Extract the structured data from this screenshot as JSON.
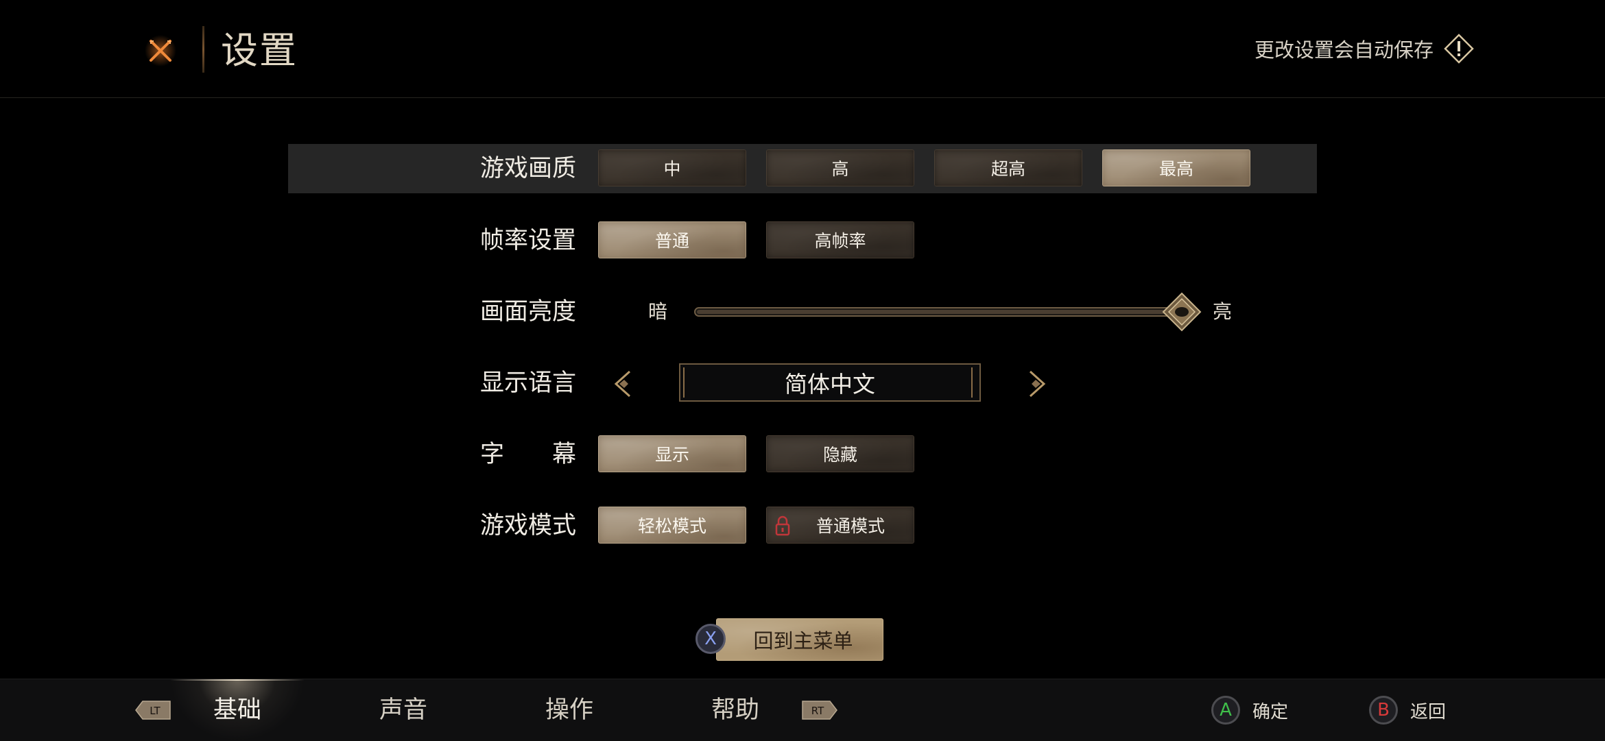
{
  "header": {
    "title": "设置",
    "autosave_notice": "更改设置会自动保存",
    "close_icon": "crossed-swords-close-icon",
    "notice_icon": "diamond-exclamation-icon"
  },
  "settings": {
    "graphics": {
      "label": "游戏画质",
      "options": [
        "中",
        "高",
        "超高",
        "最高"
      ],
      "selected": "最高"
    },
    "framerate": {
      "label": "帧率设置",
      "options": [
        "普通",
        "高帧率"
      ],
      "selected": "普通"
    },
    "brightness": {
      "label": "画面亮度",
      "min_label": "暗",
      "max_label": "亮",
      "value_fraction": 0.99
    },
    "language": {
      "label": "显示语言",
      "value": "简体中文"
    },
    "subtitles": {
      "label_chars": [
        "字",
        "幕"
      ],
      "options": [
        "显示",
        "隐藏"
      ],
      "selected": "显示"
    },
    "game_mode": {
      "label": "游戏模式",
      "options": [
        "轻松模式",
        "普通模式"
      ],
      "selected": "轻松模式",
      "locked_option": "普通模式"
    }
  },
  "main_menu_button": {
    "label": "回到主菜单",
    "key": "X"
  },
  "bottom_bar": {
    "left_shoulder": "LT",
    "right_shoulder": "RT",
    "tabs": [
      "基础",
      "声音",
      "操作",
      "帮助"
    ],
    "active_tab": "基础",
    "confirm": {
      "key": "A",
      "label": "确定",
      "color": "#3fbf4a"
    },
    "back": {
      "key": "B",
      "label": "返回",
      "color": "#d83a3a"
    }
  },
  "colors": {
    "accent_orange": "#e07a2a",
    "gold": "#b39c77",
    "selected_option": "#a08e76",
    "unselected_option": "#3b332b",
    "lock_red": "#c0363a"
  }
}
